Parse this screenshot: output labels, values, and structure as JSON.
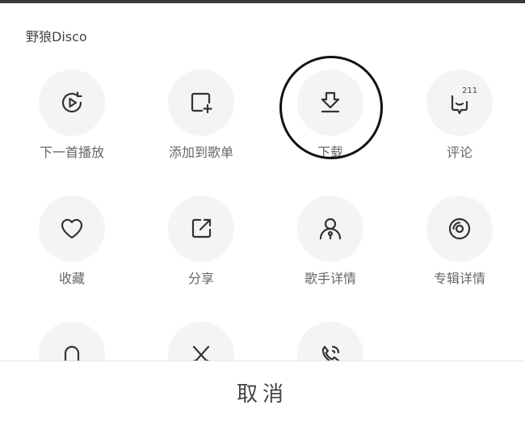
{
  "sheet": {
    "title": "野狼Disco"
  },
  "actions": [
    {
      "label": "下一首播放",
      "icon": "play-next-icon"
    },
    {
      "label": "添加到歌单",
      "icon": "add-to-playlist-icon"
    },
    {
      "label": "下载",
      "icon": "download-icon"
    },
    {
      "label": "评论",
      "icon": "comment-icon",
      "badge": "211"
    },
    {
      "label": "收藏",
      "icon": "heart-icon"
    },
    {
      "label": "分享",
      "icon": "share-icon"
    },
    {
      "label": "歌手详情",
      "icon": "artist-icon"
    },
    {
      "label": "专辑详情",
      "icon": "album-icon"
    },
    {
      "label": "",
      "icon": "bell-icon"
    },
    {
      "label": "",
      "icon": "cut-icon"
    },
    {
      "label": "",
      "icon": "ringtone-icon"
    }
  ],
  "footer": {
    "cancel_label": "取消"
  },
  "colors": {
    "icon": "#333333",
    "circle_bg": "#f4f4f4",
    "label": "#666666"
  }
}
